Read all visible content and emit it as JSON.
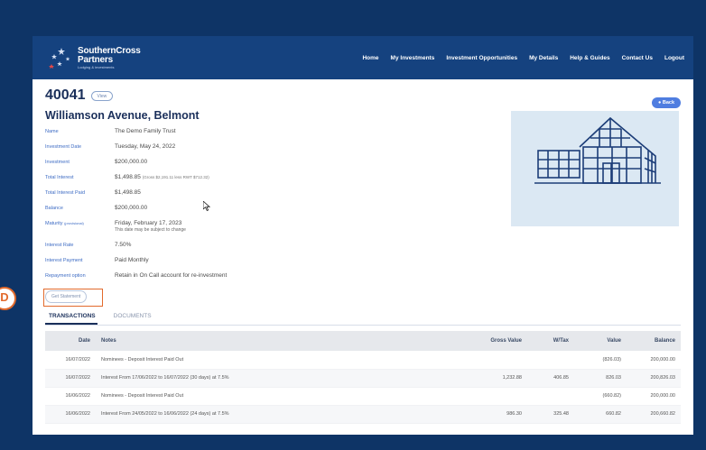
{
  "brand": {
    "name_line1": "SouthernCross",
    "name_line2": "Partners",
    "tagline": "Lodging & investments",
    "icon": "southern-cross-stars-logo"
  },
  "nav": {
    "items": [
      "Home",
      "My Investments",
      "Investment Opportunities",
      "My Details",
      "Help & Guides",
      "Contact Us",
      "Logout"
    ]
  },
  "page": {
    "number": "40041",
    "edit_label": "View",
    "back_label": "● Back",
    "subtitle": "Williamson Avenue, Belmont"
  },
  "details": {
    "name": {
      "label": "Name",
      "value": "The Demo Family Trust"
    },
    "investment_date": {
      "label": "Investment Date",
      "value": "Tuesday, May 24, 2022"
    },
    "investment": {
      "label": "Investment",
      "value": "$200,000.00"
    },
    "total_interest": {
      "label": "Total Interest",
      "value": "$1,498.85",
      "note": "(Gross $2,191.11 less RWT $712.32)"
    },
    "total_interest_paid": {
      "label": "Total Interest Paid",
      "value": "$1,498.85"
    },
    "balance": {
      "label": "Balance",
      "value": "$200,000.00"
    },
    "maturity": {
      "label": "Maturity",
      "label_note": "(provisional)",
      "value": "Friday, February 17, 2023",
      "note": "This date may be subject to change"
    },
    "interest_rate": {
      "label": "Interest Rate",
      "value": "7.50%"
    },
    "interest_payment": {
      "label": "Interest Payment",
      "value": "Paid Monthly"
    },
    "repayment_option": {
      "label": "Repayment option",
      "value": "Retain in On Call account for re-investment"
    }
  },
  "statement_button_label": "Get Statement",
  "callout_label": "D",
  "tabs": [
    {
      "label": "TRANSACTIONS",
      "active": true
    },
    {
      "label": "DOCUMENTS",
      "active": false
    }
  ],
  "transactions": {
    "headers": [
      "Date",
      "Notes",
      "Gross Value",
      "W/Tax",
      "Value",
      "Balance"
    ],
    "rows": [
      {
        "date": "16/07/2022",
        "notes": "Nominees - Deposit Interest Paid Out",
        "gross": "",
        "wtax": "",
        "value": "(826.03)",
        "balance": "200,000.00"
      },
      {
        "date": "16/07/2022",
        "notes": "Interest From 17/06/2022 to 16/07/2022 (30 days) at 7.5%",
        "gross": "1,232.88",
        "wtax": "406.85",
        "value": "826.03",
        "balance": "200,826.03"
      },
      {
        "date": "16/06/2022",
        "notes": "Nominees - Deposit Interest Paid Out",
        "gross": "",
        "wtax": "",
        "value": "(660.82)",
        "balance": "200,000.00"
      },
      {
        "date": "16/06/2022",
        "notes": "Interest From 24/05/2022 to 16/06/2022 (24 days) at 7.5%",
        "gross": "986.30",
        "wtax": "325.48",
        "value": "660.82",
        "balance": "200,660.82"
      }
    ]
  },
  "colors": {
    "background": "#0e3466",
    "nav_bar": "#15427f",
    "link_blue": "#3e6cc4",
    "heading": "#1a2f5a",
    "accent_orange": "#e26a2c",
    "illustration_bg": "#dbe8f3"
  },
  "illustration": {
    "icon": "building-greenhouse-illustration"
  }
}
